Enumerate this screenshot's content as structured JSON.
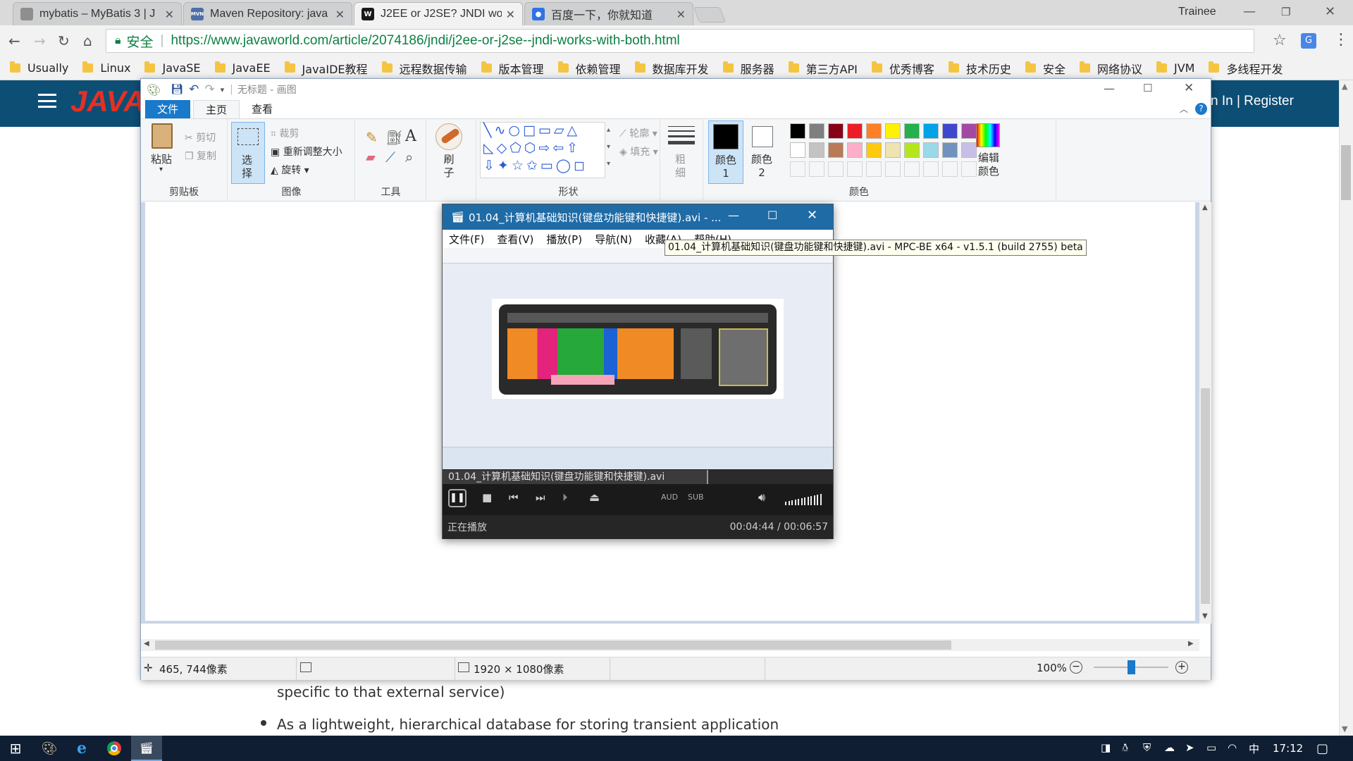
{
  "browser": {
    "tabs": [
      {
        "title": "mybatis – MyBatis 3 | J",
        "favicon": "page-icon",
        "favicon_color": "#8e8e8e"
      },
      {
        "title": "Maven Repository: java",
        "favicon": "mvn-icon",
        "favicon_color": "#4d6fa8",
        "favicon_text": "MVN"
      },
      {
        "title": "J2EE or J2SE? JNDI wor",
        "favicon": "w-icon",
        "favicon_color": "#1a1a1a",
        "favicon_text": "W",
        "active": true
      },
      {
        "title": "百度一下，你就知道",
        "favicon": "baidu-paw-icon",
        "favicon_color": "#3072e6",
        "favicon_text": "🐾"
      }
    ],
    "profile_name": "Trainee",
    "address": {
      "secure_label": "安全",
      "url": "https://www.javaworld.com/article/2074186/jndi/j2ee-or-j2se--jndi-works-with-both.html"
    },
    "bookmarks": [
      "Usually",
      "Linux",
      "JavaSE",
      "JavaEE",
      "JavaIDE教程",
      "远程数据传输",
      "版本管理",
      "依赖管理",
      "数据库开发",
      "服务器",
      "第三方API",
      "优秀博客",
      "技术历史",
      "安全",
      "网络协议",
      "JVM",
      "多线程开发"
    ]
  },
  "website": {
    "logo_text": "JAVAW",
    "signin_text": "n In  |  Register",
    "article_line1": "specific to that external service)",
    "article_line2": "As a lightweight, hierarchical database for storing transient application"
  },
  "paint": {
    "title": "无标题 - 画图",
    "tabs": [
      "文件",
      "主页",
      "查看"
    ],
    "clipboard": {
      "paste": "粘贴",
      "cut": "剪切",
      "copy": "复制",
      "label": "剪贴板"
    },
    "image": {
      "select": "选择",
      "crop": "裁剪",
      "resize": "重新调整大小",
      "rotate": "旋转",
      "label": "图像"
    },
    "tools": {
      "label": "工具"
    },
    "brush": {
      "label": "刷子"
    },
    "shapes": {
      "label": "形状",
      "outline": "轮廓",
      "fill": "填充"
    },
    "size": {
      "label": "粗细"
    },
    "color1": "颜色 1",
    "color2": "颜色 2",
    "edit_colors": "编辑颜色",
    "colors_label": "颜色",
    "palette_row1": [
      "#000000",
      "#7f7f7f",
      "#880015",
      "#ed1c24",
      "#ff7f27",
      "#fff200",
      "#22b14c",
      "#00a2e8",
      "#3f48cc",
      "#a349a4"
    ],
    "palette_row2": [
      "#ffffff",
      "#c3c3c3",
      "#b97a57",
      "#ffaec9",
      "#ffc90e",
      "#efe4b0",
      "#b5e61d",
      "#99d9ea",
      "#7092be",
      "#c8bfe7"
    ],
    "status": {
      "cursor_pos": "465, 744像素",
      "image_size": "1920 × 1080像素",
      "zoom": "100%"
    }
  },
  "mpc": {
    "title": "01.04_计算机基础知识(键盘功能键和快捷键).avi - ...",
    "menu": [
      "文件(F)",
      "查看(V)",
      "播放(P)",
      "导航(N)",
      "收藏(A)",
      "帮助(H)"
    ],
    "filename": "01.04_计算机基础知识(键盘功能键和快捷键).avi",
    "status_text": "正在播放",
    "time": "00:04:44 / 00:06:57",
    "aud_label": "AUD",
    "sub_label": "SUB",
    "playback_progress": 0.68,
    "volume_level": 1.0
  },
  "tooltip": "01.04_计算机基础知识(键盘功能键和快捷键).avi - MPC-BE x64 - v1.5.1 (build 2755) beta",
  "taskbar": {
    "clock": "17:12",
    "ime": "中"
  }
}
